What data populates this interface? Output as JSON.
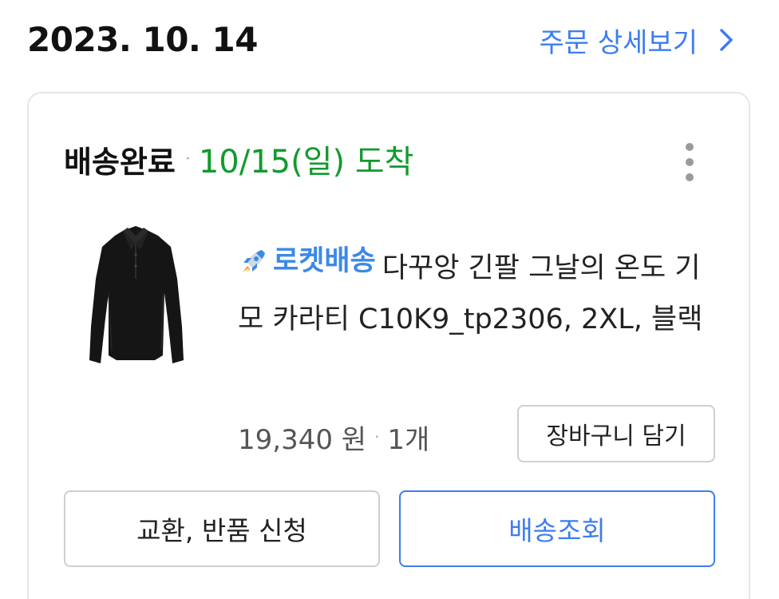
{
  "order": {
    "date": "2023. 10. 14",
    "detail_link_label": "주문 상세보기"
  },
  "shipment": {
    "status": "배송완료",
    "separator": "·",
    "arrival": "10/15(일) 도착"
  },
  "product": {
    "badge_label": "로켓배송",
    "title": "다꾸앙 긴팔 그날의 온도 기모 카라티 C10K9_tp2306, 2XL, 블랙",
    "image_alt": "black long sleeve collar shirt",
    "price": "19,340 원",
    "price_separator": "·",
    "quantity": "1개"
  },
  "actions": {
    "add_to_cart_label": "장바구니 담기",
    "exchange_return_label": "교환, 반품 신청",
    "tracking_label": "배송조회"
  },
  "icons": {
    "chevron": "chevron-right-icon",
    "more": "more-vertical-icon",
    "rocket": "rocket-icon"
  },
  "colors": {
    "link_blue": "#3d7df0",
    "arrival_green": "#139a2e",
    "rocket_blue": "#3b89e8"
  }
}
